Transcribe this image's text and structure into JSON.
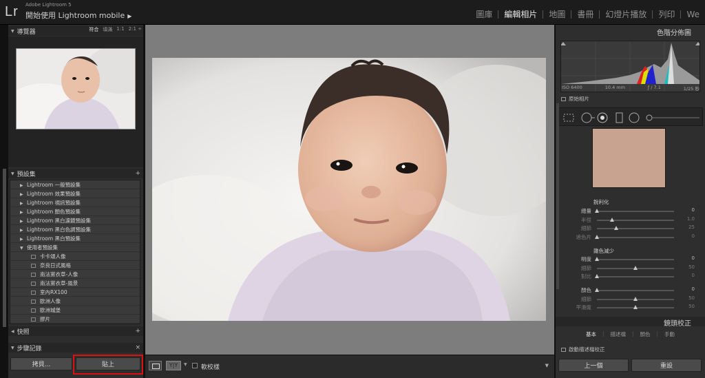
{
  "app": {
    "logo": "Lr",
    "subtitle": "Adobe Lightroom 5",
    "title": "開始使用 Lightroom mobile",
    "title_arrow": "▶"
  },
  "modules": [
    {
      "label": "圖庫",
      "active": false
    },
    {
      "label": "編輯相片",
      "active": true
    },
    {
      "label": "地圖",
      "active": false
    },
    {
      "label": "書冊",
      "active": false
    },
    {
      "label": "幻燈片播放",
      "active": false
    },
    {
      "label": "列印",
      "active": false
    },
    {
      "label": "We",
      "active": false
    }
  ],
  "navigator": {
    "title": "導覽器",
    "options": [
      "符合",
      "填滿",
      "1:1",
      "2:1 ÷"
    ]
  },
  "presets": {
    "title": "預設集",
    "add": "+",
    "items": [
      {
        "label": "Lightroom 一般預設集",
        "type": "folder"
      },
      {
        "label": "Lightroom 效果預設集",
        "type": "folder"
      },
      {
        "label": "Lightroom 視訊預設集",
        "type": "folder"
      },
      {
        "label": "Lightroom 顏色預設集",
        "type": "folder"
      },
      {
        "label": "Lightroom 黑白濾鏡預設集",
        "type": "folder"
      },
      {
        "label": "Lightroom 黑白色調預設集",
        "type": "folder"
      },
      {
        "label": "Lightroom 黑白預設集",
        "type": "folder"
      },
      {
        "label": "使用者預設集",
        "type": "open-folder"
      },
      {
        "label": "卡卡頌人像",
        "type": "preset"
      },
      {
        "label": "奈良日式風格",
        "type": "preset"
      },
      {
        "label": "南法黨衣草-人像",
        "type": "preset"
      },
      {
        "label": "南法黨衣草-風景",
        "type": "preset"
      },
      {
        "label": "室內RX100",
        "type": "preset"
      },
      {
        "label": "歐洲人像",
        "type": "preset"
      },
      {
        "label": "歐洲城堡",
        "type": "preset"
      },
      {
        "label": "膠片",
        "type": "preset"
      }
    ]
  },
  "snapshots": {
    "title": "快照",
    "add": "+"
  },
  "history": {
    "title": "步驟記錄",
    "close": "×"
  },
  "left_buttons": {
    "copy": "拷貝...",
    "paste": "貼上"
  },
  "toolbar": {
    "yy": "Y|Y",
    "softproof": "軟校樣"
  },
  "histogram": {
    "title": "色階分佈圖",
    "iso": "ISO 6400",
    "focal": "10.4 mm",
    "aperture": "ƒ / 7.1",
    "shutter": "1/25 秒",
    "original": "原始相片"
  },
  "sharpening": {
    "title": "銳利化",
    "rows": [
      {
        "label": "總量",
        "value": "0",
        "pos": 0,
        "dim": false
      },
      {
        "label": "半徑",
        "value": "1.0",
        "pos": 0.2,
        "dim": true
      },
      {
        "label": "細節",
        "value": "25",
        "pos": 0.25,
        "dim": true
      },
      {
        "label": "遮色片",
        "value": "0",
        "pos": 0,
        "dim": true
      }
    ]
  },
  "noise": {
    "title": "雜色減少",
    "rows": [
      {
        "label": "明度",
        "value": "0",
        "pos": 0,
        "dim": false
      },
      {
        "label": "細節",
        "value": "50",
        "pos": 0.5,
        "dim": true
      },
      {
        "label": "對比",
        "value": "0",
        "pos": 0,
        "dim": true
      },
      {
        "label": "顏色",
        "value": "0",
        "pos": 0,
        "dim": false
      },
      {
        "label": "細節",
        "value": "50",
        "pos": 0.5,
        "dim": true
      },
      {
        "label": "平滑度",
        "value": "50",
        "pos": 0.5,
        "dim": true
      }
    ]
  },
  "lens": {
    "title": "鏡頭校正",
    "tabs": [
      "基本",
      "描述檔",
      "顏色",
      "手動"
    ],
    "enable": "啟動描述檔校正"
  },
  "right_buttons": {
    "previous": "上一個",
    "reset": "重設"
  }
}
